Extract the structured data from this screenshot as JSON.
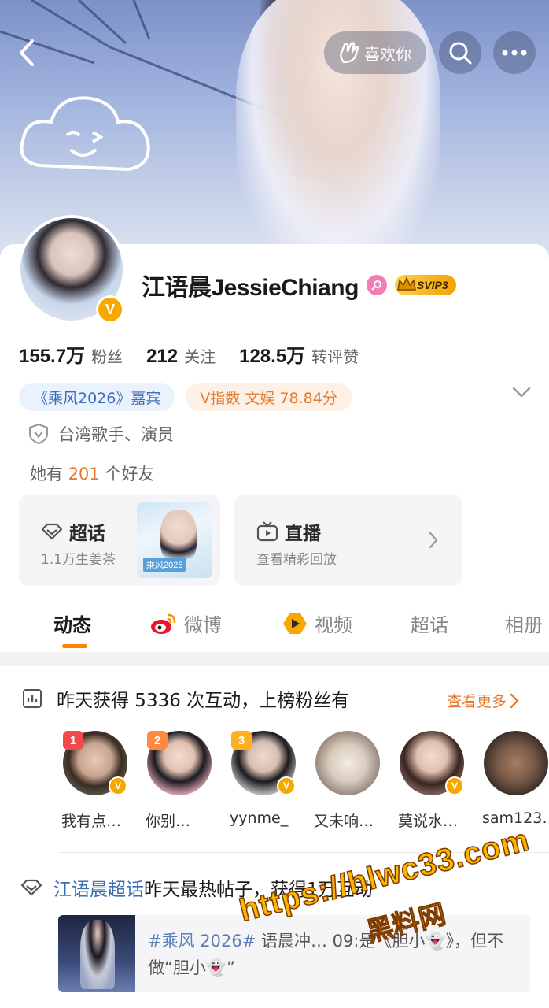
{
  "header": {
    "like_label": "喜欢你"
  },
  "profile": {
    "username": "江语晨JessieChiang",
    "svip_label": "SVIP3",
    "stats": [
      {
        "num": "155.7万",
        "label": "粉丝"
      },
      {
        "num": "212",
        "label": "关注"
      },
      {
        "num": "128.5万",
        "label": "转评赞"
      }
    ],
    "tags": [
      {
        "text": "《乘风2026》嘉宾"
      },
      {
        "text": "V指数 文娱 78.84分"
      }
    ],
    "certification": "台湾歌手、演员",
    "friends": {
      "prefix": "她有",
      "count": "201",
      "suffix": "个好友"
    }
  },
  "features": {
    "supertopic": {
      "title": "超话",
      "subtitle": "1.1万生姜茶",
      "thumb_label": "乘风2026"
    },
    "live": {
      "title": "直播",
      "subtitle": "查看精彩回放"
    }
  },
  "tabs": [
    {
      "label": "动态",
      "active": true
    },
    {
      "label": "微博",
      "active": false
    },
    {
      "label": "视频",
      "active": false
    },
    {
      "label": "超话",
      "active": false
    },
    {
      "label": "相册",
      "active": false
    }
  ],
  "interaction": {
    "title": "昨天获得 5336 次互动，上榜粉丝有",
    "see_more": "查看更多",
    "fans": [
      {
        "rank": "1",
        "name": "我有点…",
        "verified": true
      },
      {
        "rank": "2",
        "name": "你别…",
        "verified": false
      },
      {
        "rank": "3",
        "name": "yynme_",
        "verified": true
      },
      {
        "rank": "",
        "name": "又未响…",
        "verified": false
      },
      {
        "rank": "",
        "name": "莫说水…",
        "verified": true
      },
      {
        "rank": "",
        "name": "sam123…",
        "verified": false
      }
    ]
  },
  "hot_post": {
    "link": "江语晨超话",
    "text": "昨天最热帖子，获得1万互动",
    "post_hashtag": "#乘风 2026#",
    "post_text": " 语晨冲… 09:是《胆小👻》，但不做“胆小👻”"
  },
  "watermark": {
    "url": "https://hlwc33.com",
    "sub": "黑料网"
  },
  "colors": {
    "accent_orange": "#ff8200",
    "link_blue": "#3d6fb6",
    "verified_gold": "#f7a800",
    "rank_red": "#f24a4a",
    "rank_orange": "#ff8a3d",
    "rank_yellow": "#ffb020"
  }
}
